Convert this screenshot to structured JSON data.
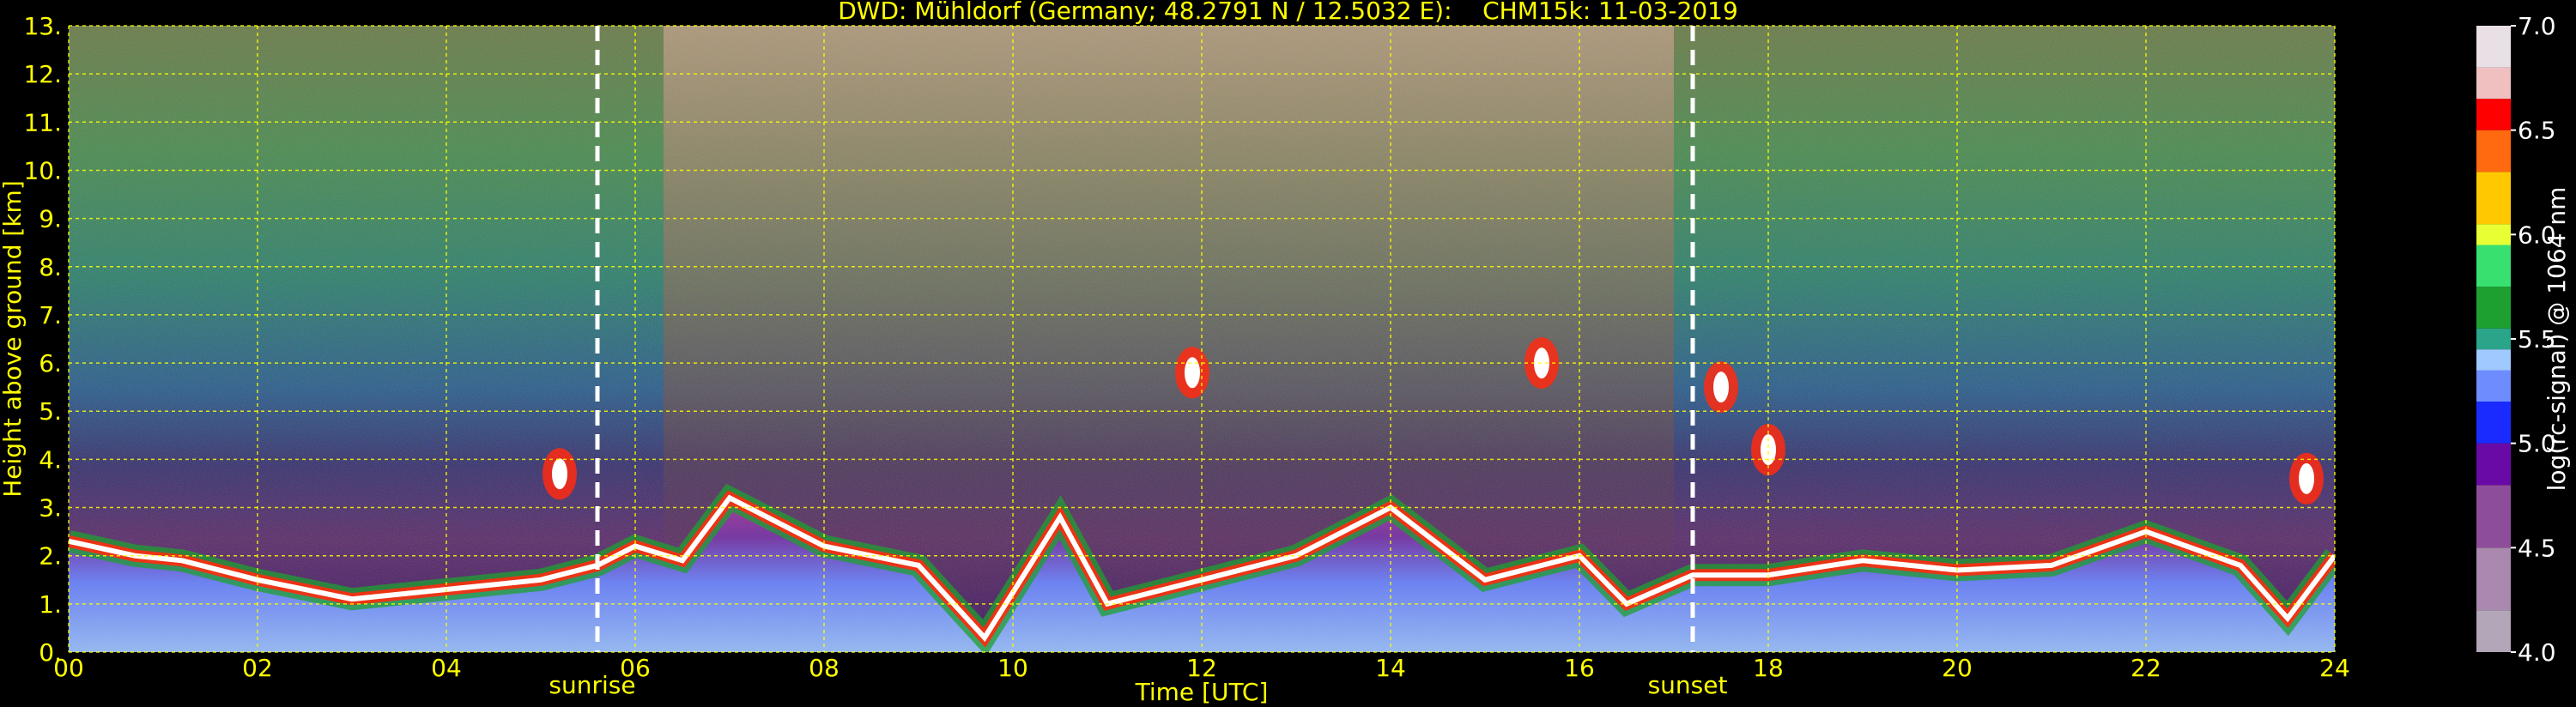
{
  "title": "DWD: Mühldorf (Germany; 48.2791 N / 12.5032 E):    CHM15k: 11-03-2019",
  "colors": {
    "text": "#ffff00",
    "grid": "#ffff00",
    "background": "#000000",
    "day_marker": "#ffffff"
  },
  "chart_data": {
    "type": "heatmap",
    "title": "DWD: Mühldorf (Germany; 48.2791 N / 12.5032 E):    CHM15k: 11-03-2019",
    "xlabel": "Time [UTC]",
    "ylabel": "Height above ground [km]",
    "xlim": [
      0,
      24
    ],
    "ylim": [
      0,
      13
    ],
    "x_ticks": [
      "00",
      "02",
      "04",
      "06",
      "08",
      "10",
      "12",
      "14",
      "16",
      "18",
      "20",
      "22",
      "24"
    ],
    "y_ticks": [
      "0.",
      "1.",
      "2.",
      "3.",
      "4.",
      "5.",
      "6.",
      "7.",
      "8.",
      "9.",
      "10.",
      "11.",
      "12.",
      "13."
    ],
    "grid": true,
    "annotations": [
      {
        "label": "sunrise",
        "time": 5.6
      },
      {
        "label": "sunset",
        "time": 17.2
      }
    ],
    "boundary_layer_top_km": [
      {
        "t": 0.0,
        "h": 2.3
      },
      {
        "t": 0.7,
        "h": 2.0
      },
      {
        "t": 1.2,
        "h": 1.9
      },
      {
        "t": 2.0,
        "h": 1.5
      },
      {
        "t": 3.0,
        "h": 1.1
      },
      {
        "t": 4.0,
        "h": 1.3
      },
      {
        "t": 5.0,
        "h": 1.5
      },
      {
        "t": 5.6,
        "h": 1.8
      },
      {
        "t": 6.0,
        "h": 2.2
      },
      {
        "t": 6.5,
        "h": 1.9
      },
      {
        "t": 7.0,
        "h": 3.2
      },
      {
        "t": 8.0,
        "h": 2.2
      },
      {
        "t": 9.0,
        "h": 1.8
      },
      {
        "t": 9.7,
        "h": 0.3
      },
      {
        "t": 10.5,
        "h": 2.8
      },
      {
        "t": 11.0,
        "h": 1.0
      },
      {
        "t": 12.0,
        "h": 1.5
      },
      {
        "t": 13.0,
        "h": 2.0
      },
      {
        "t": 14.0,
        "h": 3.0
      },
      {
        "t": 15.0,
        "h": 1.5
      },
      {
        "t": 16.0,
        "h": 2.0
      },
      {
        "t": 16.5,
        "h": 1.0
      },
      {
        "t": 17.2,
        "h": 1.6
      },
      {
        "t": 18.0,
        "h": 1.6
      },
      {
        "t": 19.0,
        "h": 1.9
      },
      {
        "t": 20.0,
        "h": 1.7
      },
      {
        "t": 21.0,
        "h": 1.8
      },
      {
        "t": 22.0,
        "h": 2.5
      },
      {
        "t": 23.0,
        "h": 1.8
      },
      {
        "t": 23.5,
        "h": 0.7
      },
      {
        "t": 24.0,
        "h": 2.0
      }
    ],
    "cloud_features": [
      {
        "t": 5.2,
        "h": 3.7
      },
      {
        "t": 11.9,
        "h": 5.8
      },
      {
        "t": 15.6,
        "h": 6.0
      },
      {
        "t": 17.5,
        "h": 5.5
      },
      {
        "t": 18.0,
        "h": 4.2
      },
      {
        "t": 23.7,
        "h": 3.6
      }
    ],
    "colorbar": {
      "label": "log(rc-signal) @ 1064 nm",
      "range": [
        4.0,
        7.0
      ],
      "ticks": [
        "4.0",
        "4.5",
        "5.0",
        "5.5",
        "6.0",
        "6.5",
        "7.0"
      ],
      "stops": [
        {
          "v": 4.0,
          "c": "#b3a6b8"
        },
        {
          "v": 4.2,
          "c": "#a98aae"
        },
        {
          "v": 4.5,
          "c": "#8e4d9b"
        },
        {
          "v": 4.8,
          "c": "#6a0aa6"
        },
        {
          "v": 5.0,
          "c": "#1a2bff"
        },
        {
          "v": 5.2,
          "c": "#6f8cff"
        },
        {
          "v": 5.35,
          "c": "#9fc9ff"
        },
        {
          "v": 5.45,
          "c": "#2aa58a"
        },
        {
          "v": 5.55,
          "c": "#1ea030"
        },
        {
          "v": 5.75,
          "c": "#38e070"
        },
        {
          "v": 5.95,
          "c": "#e8ff33"
        },
        {
          "v": 6.05,
          "c": "#ffc800"
        },
        {
          "v": 6.3,
          "c": "#ff6a10"
        },
        {
          "v": 6.5,
          "c": "#ff0000"
        },
        {
          "v": 6.65,
          "c": "#f0c0c0"
        },
        {
          "v": 6.8,
          "c": "#e8e0e4"
        },
        {
          "v": 7.0,
          "c": "#ffffff"
        }
      ]
    }
  }
}
